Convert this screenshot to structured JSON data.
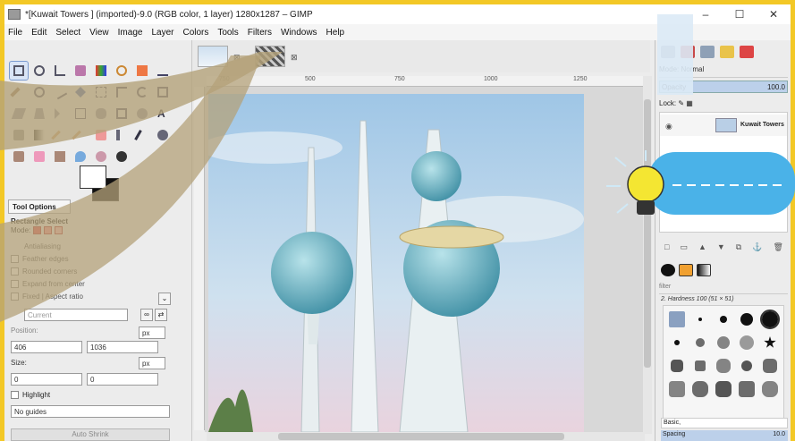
{
  "window": {
    "title": "*[Kuwait Towers ] (imported)-9.0 (RGB color, 1 layer) 1280x1287 – GIMP",
    "minimize": "–",
    "maximize": "☐",
    "close": "✕"
  },
  "menu": [
    "File",
    "Edit",
    "Select",
    "View",
    "Image",
    "Layer",
    "Colors",
    "Tools",
    "Filters",
    "Windows",
    "Help"
  ],
  "ruler": {
    "ticks": [
      "750",
      "500",
      "750",
      "1000",
      "1250"
    ]
  },
  "tool_options": {
    "tab": "Tool Options",
    "tool": "Rectangle Select",
    "mode_label": "Mode:",
    "antialiasing": "Antialiasing",
    "feather": "Feather edges",
    "rounded": "Rounded corners",
    "expand": "Expand from center",
    "fixed": "Fixed | Aspect ratio",
    "current": "Current",
    "position_label": "Position:",
    "position_x": "406",
    "position_y": "1036",
    "unit": "px",
    "size_label": "Size:",
    "size_w": "0",
    "size_h": "0",
    "highlight": "Highlight",
    "guides": "No guides",
    "auto_shrink": "Auto Shrink"
  },
  "layers": {
    "mode": "Mode: Normal",
    "opacity_label": "Opacity",
    "opacity_value": "100.0",
    "lock_label": "Lock:",
    "layer_name": "Kuwait Towers"
  },
  "brushes": {
    "filter": "filter",
    "brush_name": "2. Hardness 100 (51 × 51)",
    "tag": "Basic,",
    "spacing_label": "Spacing",
    "spacing_value": "10.0"
  },
  "colors": {
    "accent": "#f3c826",
    "selection": "#bcd0ea"
  }
}
